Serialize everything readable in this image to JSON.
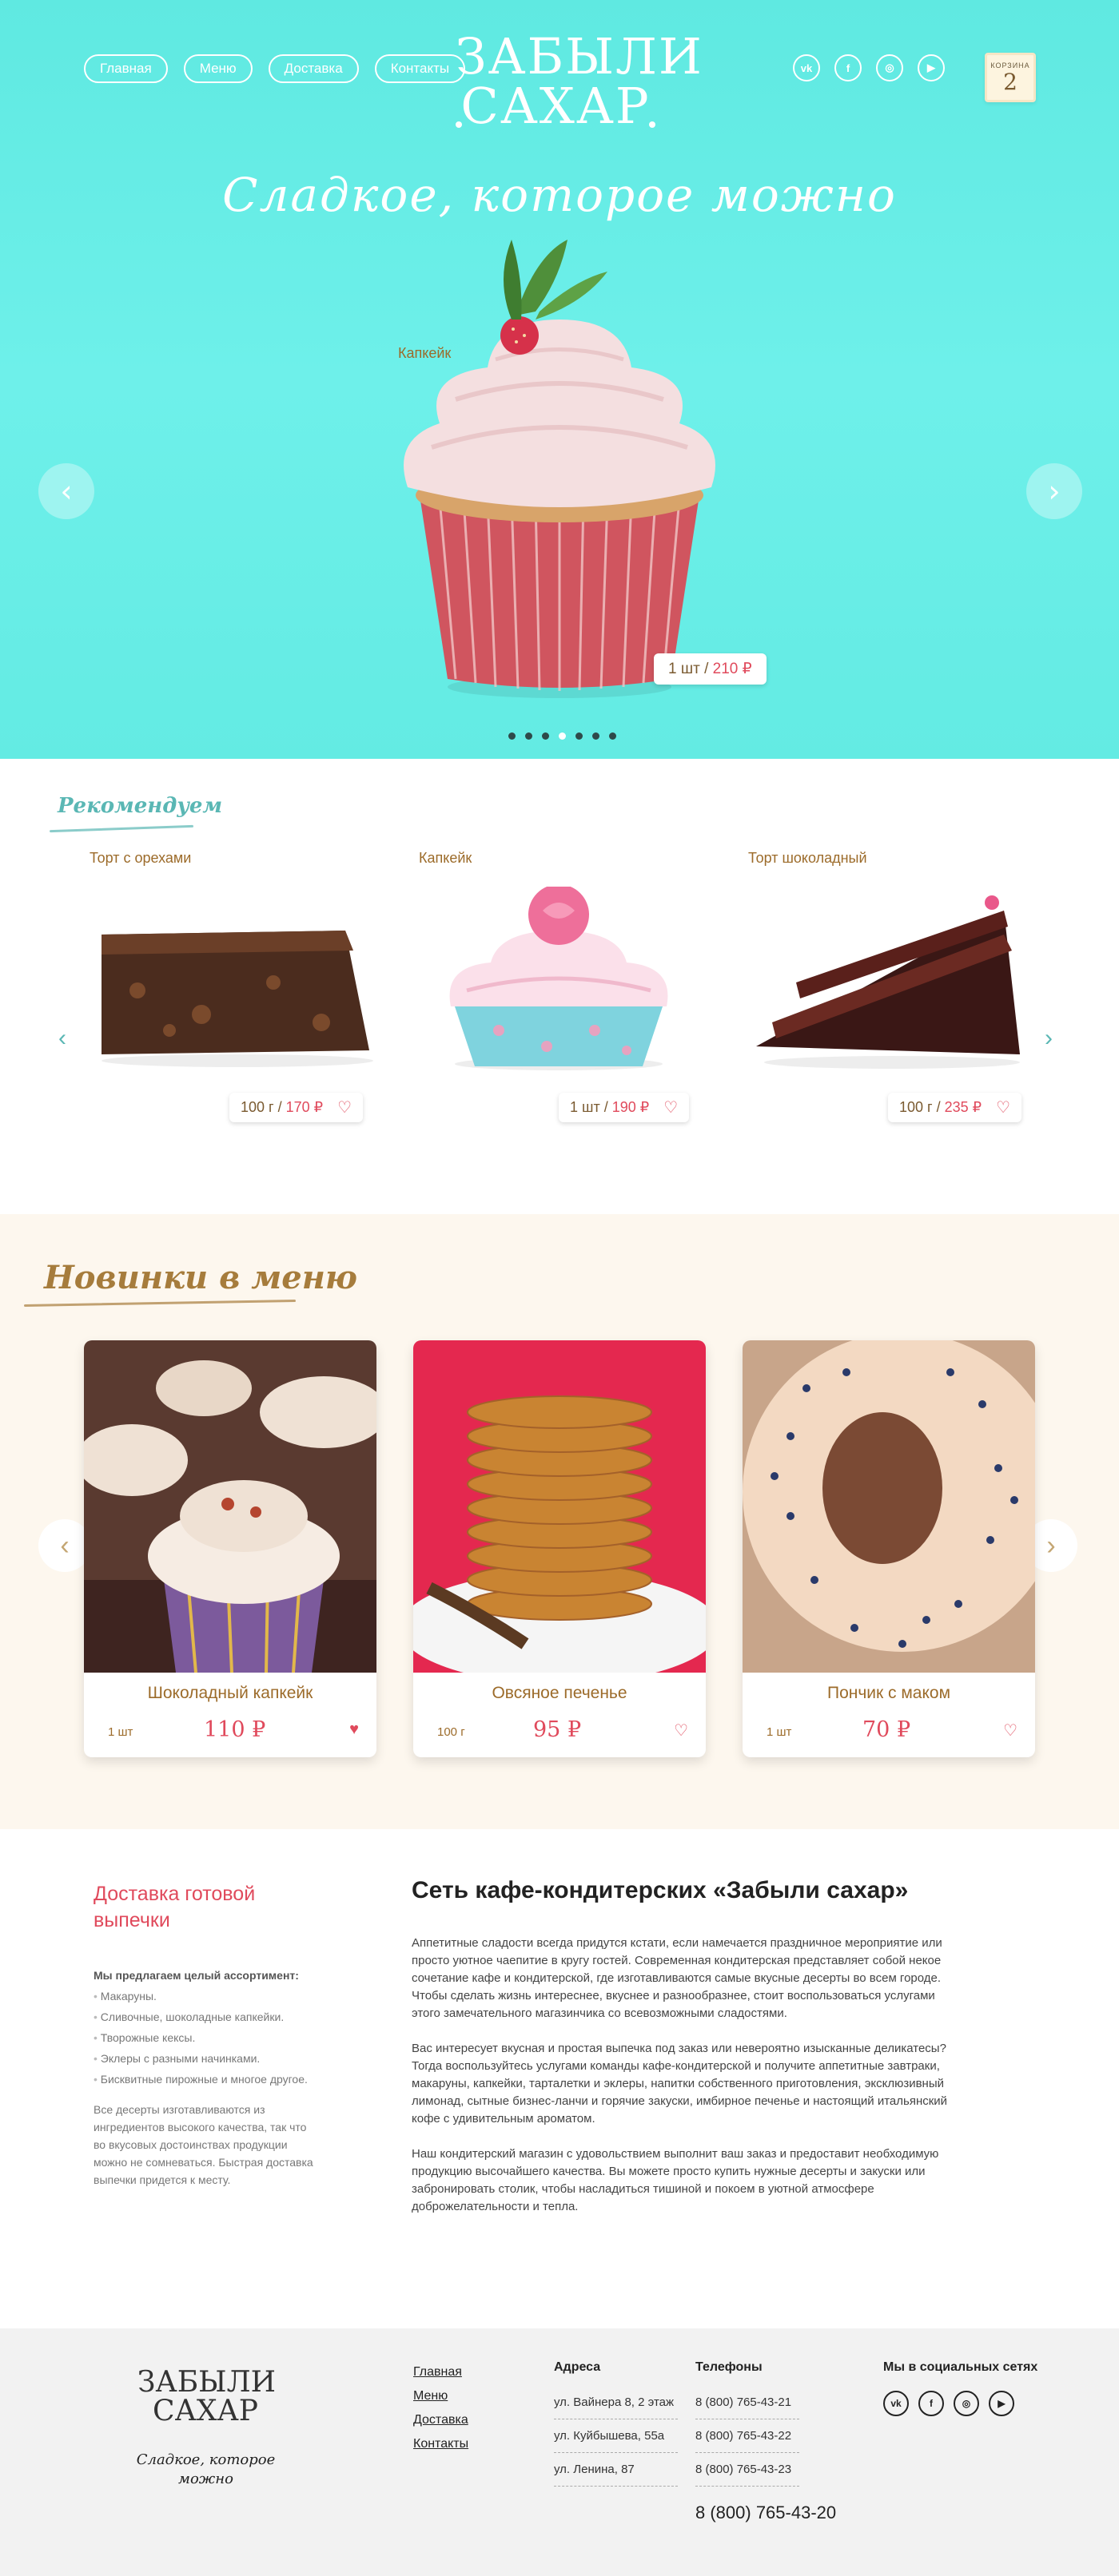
{
  "header": {
    "nav": [
      "Главная",
      "Меню",
      "Доставка",
      "Контакты"
    ],
    "logo_line1": "Забыли",
    "logo_line2": "сахар",
    "socials": [
      "vk-icon",
      "facebook-icon",
      "instagram-icon",
      "youtube-icon"
    ],
    "social_glyphs": [
      "vk",
      "f",
      "◎",
      "▶"
    ],
    "cart_label": "КОРЗИНА",
    "cart_count": "2"
  },
  "hero": {
    "slogan": "Сладкое, которое можно",
    "product_name": "Капкейк",
    "price_qty": "1 шт /",
    "price_value": "210 ₽",
    "slides_total": 7,
    "active_slide": 4
  },
  "recommend": {
    "title": "Рекомендуем",
    "items": [
      {
        "name": "Торт с орехами",
        "qty": "100 г /",
        "price": "170 ₽"
      },
      {
        "name": "Капкейк",
        "qty": "1 шт /",
        "price": "190 ₽"
      },
      {
        "name": "Торт шоколадный",
        "qty": "100 г /",
        "price": "235 ₽"
      }
    ]
  },
  "new_items": {
    "title": "Новинки в меню",
    "items": [
      {
        "name": "Шоколадный капкейк",
        "unit": "1 шт",
        "price": "110 ₽",
        "favorite": true
      },
      {
        "name": "Овсяное печенье",
        "unit": "100 г",
        "price": "95 ₽",
        "favorite": false
      },
      {
        "name": "Пончик с маком",
        "unit": "1 шт",
        "price": "70 ₽",
        "favorite": false
      }
    ]
  },
  "about": {
    "delivery_title": "Доставка готовой выпечки",
    "assortment_heading": "Мы предлагаем целый ассортимент:",
    "assortment": [
      "Макаруны.",
      "Сливочные, шоколадные капкейки.",
      "Творожные кексы.",
      "Эклеры с разными начинками.",
      "Бисквитные пирожные и многое другое."
    ],
    "assortment_note": "Все десерты изготавливаются из ингредиентов высокого качества, так что во вкусовых достоинствах продукции можно не сомневаться. Быстрая доставка выпечки придется к месту.",
    "title": "Сеть кафе-кондитерских «Забыли сахар»",
    "paragraphs": [
      "Аппетитные сладости всегда придутся кстати, если намечается праздничное мероприятие или просто уютное чаепитие в кругу гостей. Современная кондитерская представляет собой некое сочетание кафе и кондитерской, где изготавливаются самые вкусные десерты во всем городе. Чтобы сделать жизнь интереснее, вкуснее и разнообразнее, стоит воспользоваться услугами этого замечательного магазинчика со всевозможными сладостями.",
      "Вас интересует вкусная и простая выпечка под заказ или невероятно изысканные деликатесы? Тогда воспользуйтесь услугами команды кафе-кондитерской и получите аппетитные завтраки, макаруны, капкейки, тарталетки и эклеры, напитки собственного приготовления, эксклюзивный лимонад, сытные бизнес-ланчи и горячие закуски, имбирное печенье и настоящий итальянский кофе с удивительным ароматом.",
      "Наш кондитерский магазин с удовольствием выполнит ваш заказ и предоставит необходимую продукцию высочайшего качества. Вы можете просто купить нужные десерты и закуски или забронировать столик, чтобы насладиться тишиной и покоем в уютной атмосфере доброжелательности и тепла."
    ]
  },
  "footer": {
    "logo_line1": "Забыли",
    "logo_line2": "сахар",
    "slogan": "Сладкое, которое можно",
    "menu": [
      "Главная",
      "Меню",
      "Доставка",
      "Контакты"
    ],
    "address_heading": "Адреса",
    "phones_heading": "Телефоны",
    "social_heading": "Мы в социальных сетях",
    "rows": [
      {
        "address": "ул. Вайнера 8, 2 этаж",
        "phone": "8 (800) 765-43-21"
      },
      {
        "address": "ул. Куйбышева, 55а",
        "phone": "8 (800) 765-43-22"
      },
      {
        "address": "ул. Ленина, 87",
        "phone": "8 (800) 765-43-23"
      }
    ],
    "main_phone": "8 (800) 765-43-20"
  },
  "colors": {
    "hero_bg": "#63ebe3",
    "accent_red": "#e04a5c",
    "brown_text": "#9c6b2a",
    "teal": "#5ab7b4",
    "cream_bg": "#fdf7ee"
  }
}
